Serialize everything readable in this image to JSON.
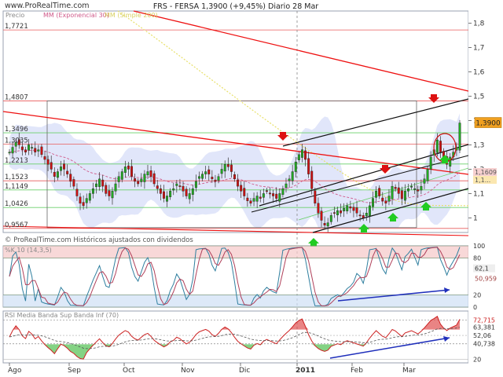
{
  "header": {
    "site": "www.ProRealTime.com",
    "title": "FRS - FERSA   1,3900 (+9,45%)   Diario  28 Mar"
  },
  "legend": {
    "price": "Precio",
    "ema": "MM (Exponencial 30)",
    "sma": "MM (Simple 200)"
  },
  "copyright": "© ProRealTime.com  Históricos ajustados con dividendos",
  "oscillator": {
    "label": "%K 10 (14,3,5)",
    "levels": [
      "100",
      "80",
      "20",
      "0"
    ],
    "current": [
      "62,1",
      "50,959"
    ]
  },
  "rsi": {
    "label": "RSI  Media  Banda Sup  Banda Inf (70)",
    "levels": [
      "72,715",
      "63,381",
      "52,06",
      "40,738",
      "20"
    ]
  },
  "colors": {
    "up": "#22aa22",
    "down": "#cc1111",
    "trend_red": "#ee1111",
    "trend_black": "#111111",
    "band": "#c8d2f5",
    "level_green": "#6ad06a",
    "level_red": "#e85a5a",
    "arrow_green": "#22cc22",
    "arrow_red": "#dd1111",
    "blue_arrow": "#1f2fbb",
    "label_current_bg": "#f0a020"
  },
  "chart_data": {
    "type": "candlestick",
    "title": "FRS - FERSA 1,3900 (+9,45%) Diario 28 Mar",
    "y_axis": {
      "ticks": [
        "1,8",
        "1,7",
        "1,6",
        "1,5",
        "1,4",
        "1,3",
        "1,2",
        "1,1",
        "1"
      ],
      "range": [
        0.94,
        1.85
      ]
    },
    "x_axis": {
      "labels": [
        "Ago",
        "Sep",
        "Oct",
        "Nov",
        "Dic",
        "2011",
        "Feb",
        "Mar"
      ]
    },
    "price_levels": [
      "1,7721",
      "1,4807",
      "1,3496",
      "1,3035",
      "1,2213",
      "1,1523",
      "1,1149",
      "1,0426",
      "0,9567"
    ],
    "current_price": "1,3900",
    "right_labels": [
      "1,1609",
      "1,1..."
    ],
    "closes": [
      1.27,
      1.29,
      1.31,
      1.3,
      1.28,
      1.27,
      1.3,
      1.29,
      1.27,
      1.28,
      1.26,
      1.24,
      1.22,
      1.2,
      1.17,
      1.19,
      1.21,
      1.2,
      1.18,
      1.15,
      1.13,
      1.09,
      1.06,
      1.05,
      1.08,
      1.1,
      1.12,
      1.14,
      1.16,
      1.13,
      1.1,
      1.09,
      1.11,
      1.14,
      1.17,
      1.19,
      1.21,
      1.2,
      1.17,
      1.15,
      1.14,
      1.16,
      1.18,
      1.19,
      1.17,
      1.14,
      1.12,
      1.1,
      1.08,
      1.09,
      1.11,
      1.12,
      1.14,
      1.13,
      1.11,
      1.09,
      1.1,
      1.12,
      1.15,
      1.17,
      1.18,
      1.19,
      1.18,
      1.16,
      1.15,
      1.17,
      1.2,
      1.22,
      1.21,
      1.19,
      1.16,
      1.13,
      1.11,
      1.09,
      1.07,
      1.06,
      1.08,
      1.09,
      1.08,
      1.1,
      1.11,
      1.1,
      1.09,
      1.08,
      1.1,
      1.12,
      1.14,
      1.16,
      1.19,
      1.23,
      1.26,
      1.28,
      1.24,
      1.18,
      1.12,
      1.06,
      1.02,
      0.99,
      0.97,
      0.98,
      1.01,
      1.02,
      1.03,
      1.02,
      1.04,
      1.05,
      1.04,
      1.03,
      1.02,
      1.01,
      1.0,
      1.02,
      1.05,
      1.08,
      1.11,
      1.09,
      1.07,
      1.06,
      1.09,
      1.13,
      1.12,
      1.1,
      1.08,
      1.11,
      1.12,
      1.13,
      1.12,
      1.11,
      1.13,
      1.16,
      1.2,
      1.25,
      1.28,
      1.32,
      1.27,
      1.24,
      1.22,
      1.25,
      1.27,
      1.29,
      1.39
    ]
  }
}
